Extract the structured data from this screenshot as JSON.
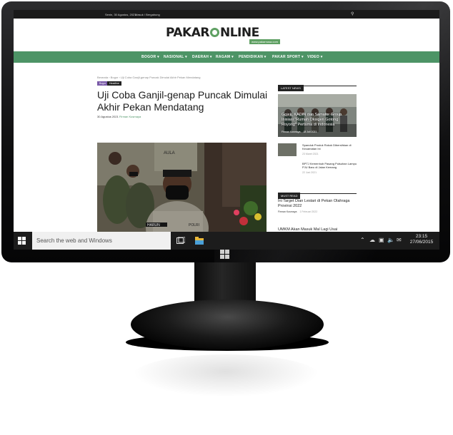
{
  "topbar": {
    "date": "Senin, 30 Agustus, 2021",
    "login": "Masuk / Bergabung"
  },
  "brand": {
    "logo_part1": "PAKAR",
    "logo_part2": "NLINE",
    "tagline": "www.pakarnusa.com"
  },
  "nav": [
    "BOGOR ▾",
    "NASIONAL ▾",
    "DAERAH ▾",
    "RAGAM ▾",
    "PENDIDIKAN ▾",
    "PAKAR SPORT ▾",
    "VIDEO ▾"
  ],
  "article": {
    "breadcrumb": "Beranda  ›  Bogor  ›  Uji Coba Ganjil-genap Puncak Dimulai Akhir Pekan Mendatang",
    "tags": [
      "Bogor",
      "Headline"
    ],
    "title": "Uji Coba Ganjil-genap Puncak Dimulai Akhir Pekan Mendatang",
    "date": "30 Agustus 2021",
    "author": "Firman Kusmaya",
    "photo_labels": {
      "wall": "AULA",
      "name_tag": "HARUN",
      "badge": "POLRI"
    }
  },
  "sidebar": {
    "latest_heading": "LATEST NEWS",
    "featured": {
      "title": "Gojek, KADIN dan Samator Group Inisiasi \"Rumah Oksigen Gotong Royong\" Pertama di Indonesia",
      "author": "Firman Kusmaya",
      "date": "18 Juli 2021"
    },
    "news": [
      {
        "title": "Spanduk Produk Rokok Dibersihkan di Kecamatan Ini",
        "date": "23 Maret 2021"
      },
      {
        "title": "BPTJ Kemenhub Pasang Pulsuhan Lampu PJU Baru di Jalan Kemang",
        "date": "22 Juni 2021"
      }
    ],
    "must_heading": "MUST READ",
    "must": [
      {
        "title": "Ini Target Dian Lestari di Pekan Olahraga Provinsi 2022",
        "author": "Firman Kusmaya",
        "date": "1 Februari 2022"
      },
      {
        "title": "UMKM Akan Masuk Mal Lagi Usai",
        "author": "",
        "date": ""
      }
    ]
  },
  "taskbar": {
    "search_placeholder": "Search the web and Windows",
    "time": "23:15",
    "date": "27/06/2015"
  },
  "colors": {
    "accent": "#4d9466",
    "topbar": "#1a1a1a",
    "taskbar": "#1c1c1c"
  }
}
